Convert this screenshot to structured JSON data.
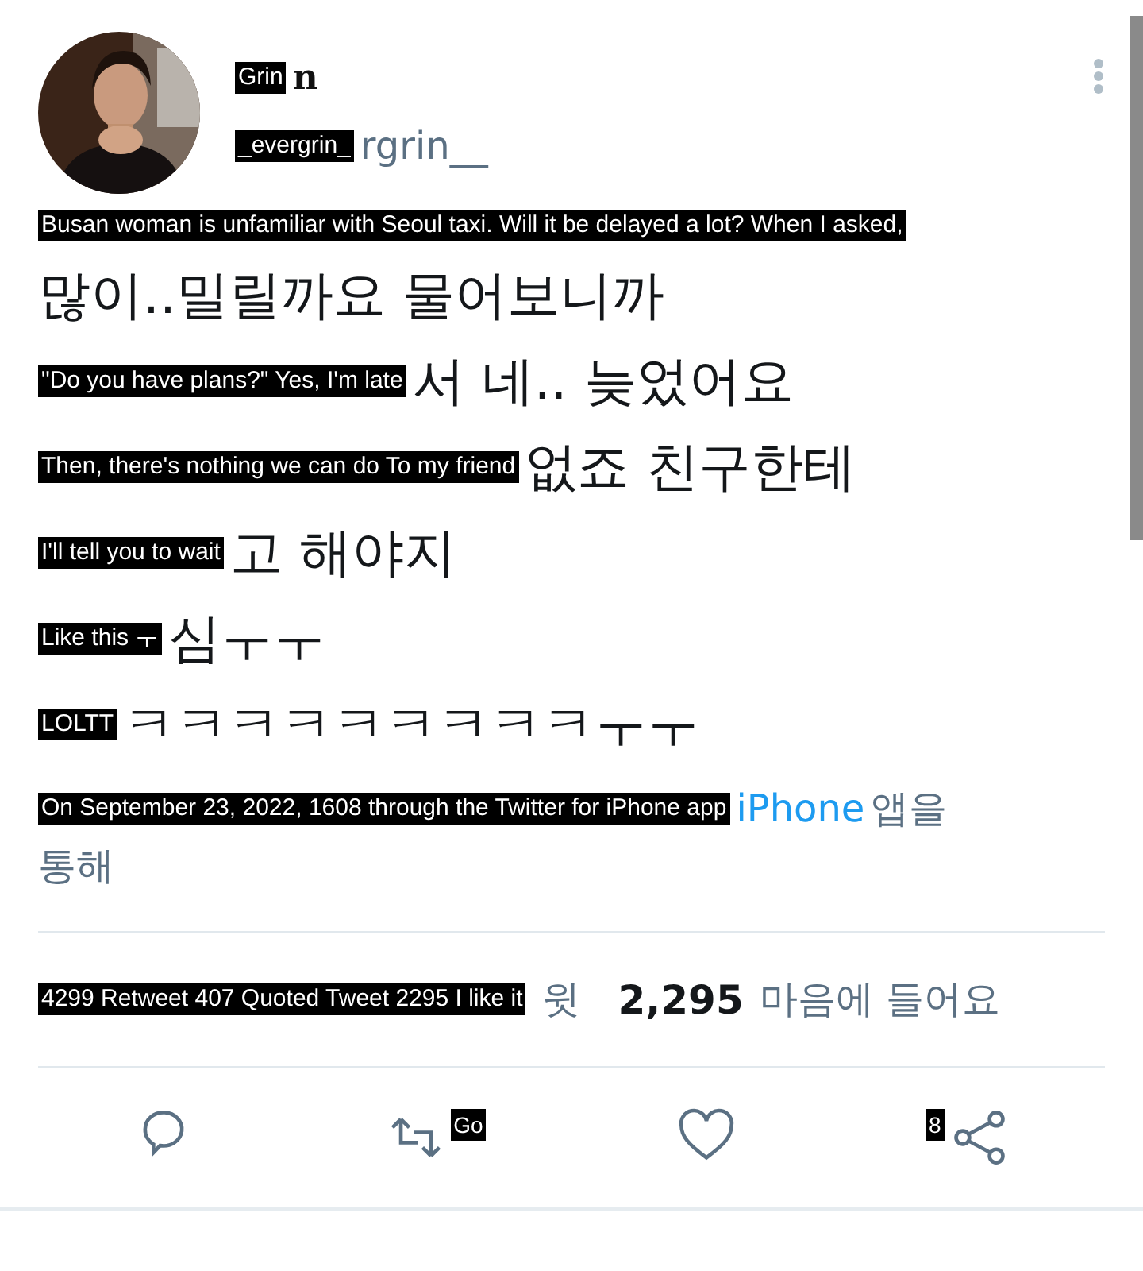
{
  "author": {
    "name": [
      {
        "kind": "overlay",
        "text": "Grin"
      },
      {
        "kind": "text",
        "text": "n"
      }
    ],
    "handle": [
      {
        "kind": "overlay",
        "text": "_evergrin_"
      },
      {
        "kind": "text",
        "text": "rgrin__"
      }
    ]
  },
  "body": [
    [
      {
        "kind": "overlay",
        "text": "Busan woman is unfamiliar with Seoul taxi. Will it be delayed a lot? When I asked,"
      }
    ],
    [
      {
        "kind": "text",
        "text": "많이..밀릴까요 물어보니까"
      }
    ],
    [
      {
        "kind": "overlay",
        "text": "\"Do you have plans?\" Yes, I'm late"
      },
      {
        "kind": "text",
        "text": "서 네.. 늦었어요"
      }
    ],
    [
      {
        "kind": "overlay",
        "text": "Then, there's nothing we can do To my friend"
      },
      {
        "kind": "text",
        "text": "없죠 친구한테"
      }
    ],
    [
      {
        "kind": "overlay",
        "text": "I'll tell you to wait"
      },
      {
        "kind": "text",
        "text": "고 해야지"
      }
    ],
    [
      {
        "kind": "overlay",
        "text": "Like this ㅜ"
      },
      {
        "kind": "text",
        "text": "심ㅜㅜ"
      }
    ],
    [
      {
        "kind": "overlay",
        "text": "LOLTT"
      },
      {
        "kind": "text",
        "text": "ㅋㅋㅋㅋㅋㅋㅋㅋㅋㅜㅜ"
      }
    ]
  ],
  "meta": [
    [
      {
        "kind": "overlay",
        "text": "On September 23, 2022, 1608 through the Twitter for iPhone app"
      },
      {
        "kind": "link",
        "text": "iPhone"
      },
      {
        "kind": "text",
        "text": "앱을"
      }
    ],
    [
      {
        "kind": "text",
        "text": "통해"
      }
    ]
  ],
  "stats": [
    {
      "kind": "overlay",
      "text": "4299 Retweet 407 Quoted Tweet 2295 I like it"
    },
    {
      "kind": "text",
      "text": "윗"
    },
    {
      "kind": "bold",
      "text": "2,295"
    },
    {
      "kind": "text",
      "text": "마음에 들어요"
    }
  ],
  "actions": [
    {
      "kind": "reply"
    },
    {
      "kind": "retweet",
      "label": "Go"
    },
    {
      "kind": "like"
    },
    {
      "kind": "share",
      "label": "8"
    }
  ]
}
